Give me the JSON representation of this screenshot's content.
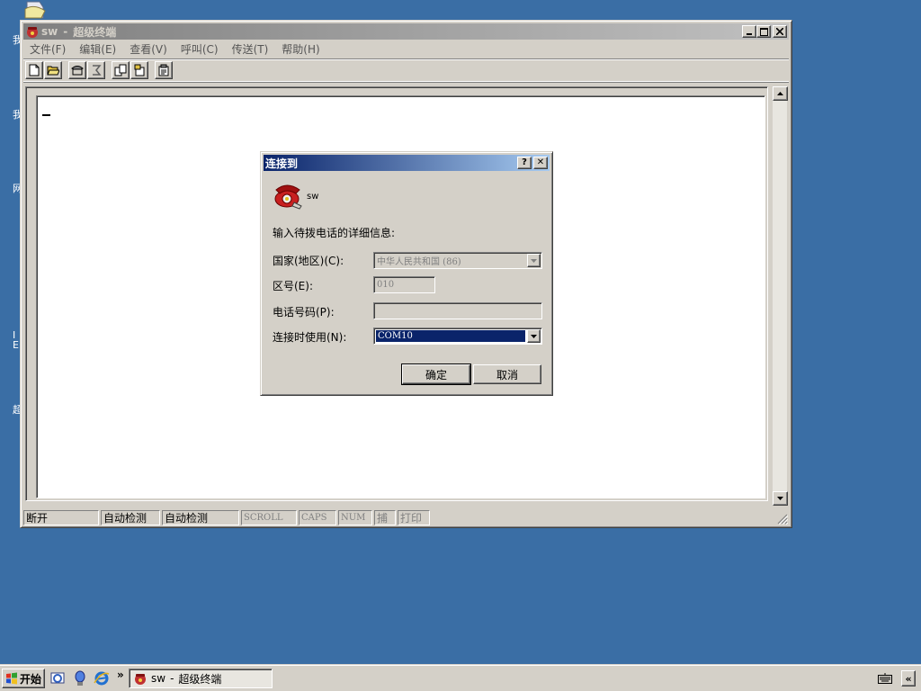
{
  "desktop": {
    "icon_labels": [
      "我",
      "我",
      "网",
      "I E",
      "超"
    ]
  },
  "window": {
    "title_name": "sw",
    "title_separator": "-",
    "title_app": "超级终端",
    "menu": [
      "文件(F)",
      "编辑(E)",
      "查看(V)",
      "呼叫(C)",
      "传送(T)",
      "帮助(H)"
    ],
    "status": {
      "connection": "断开",
      "detect1": "自动检测",
      "detect2": "自动检测",
      "scroll": "SCROLL",
      "caps": "CAPS",
      "num": "NUM",
      "capture": "捕",
      "print": "打印"
    }
  },
  "dialog": {
    "title": "连接到",
    "connection_name": "sw",
    "prompt": "输入待拨电话的详细信息:",
    "country_label": "国家(地区)(C):",
    "country_value": "中华人民共和国 (86)",
    "area_label": "区号(E):",
    "area_value": "010",
    "phone_label": "电话号码(P):",
    "phone_value": "",
    "connect_using_label": "连接时使用(N):",
    "connect_using_value": "COM10",
    "ok_label": "确定",
    "cancel_label": "取消",
    "help_glyph": "?",
    "close_glyph": "✕"
  },
  "taskbar": {
    "start_label": "开始",
    "chevron": "»",
    "task_name": "sw",
    "task_separator": "-",
    "task_app": "超级终端",
    "tray_chevron": "«"
  },
  "colors": {
    "desktop": "#3a6ea5",
    "dialog_title_start": "#0a246a",
    "dialog_title_end": "#a6caf0",
    "inactive_title_start": "#808080",
    "inactive_title_end": "#c0c0c0",
    "selection": "#0a246a"
  }
}
